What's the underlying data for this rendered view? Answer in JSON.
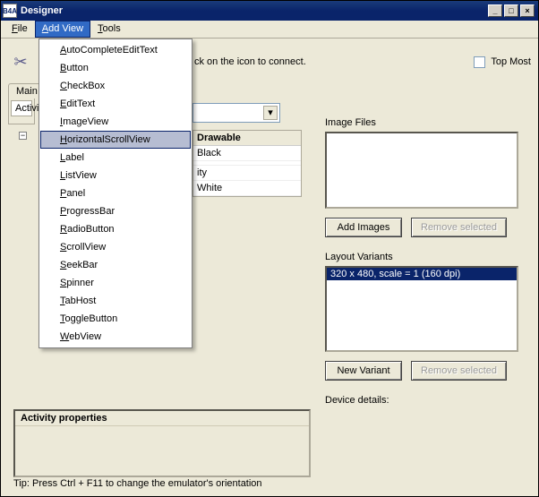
{
  "window": {
    "appicon_text": "B4A",
    "title": "Designer"
  },
  "menu": {
    "file": "File",
    "addview": "Add View",
    "tools": "Tools"
  },
  "addview_items": [
    {
      "mn": "A",
      "rest": "utoCompleteEditText"
    },
    {
      "mn": "B",
      "rest": "utton"
    },
    {
      "mn": "C",
      "rest": "heckBox"
    },
    {
      "mn": "E",
      "rest": "ditText"
    },
    {
      "mn": "I",
      "rest": "mageView"
    },
    {
      "mn": "H",
      "rest": "orizontalScrollView"
    },
    {
      "mn": "L",
      "rest": "abel"
    },
    {
      "mn": "L",
      "rest": "istView"
    },
    {
      "mn": "P",
      "rest": "anel"
    },
    {
      "mn": "P",
      "rest": "rogressBar"
    },
    {
      "mn": "R",
      "rest": "adioButton"
    },
    {
      "mn": "S",
      "rest": "crollView"
    },
    {
      "mn": "S",
      "rest": "eekBar"
    },
    {
      "mn": "S",
      "rest": "pinner"
    },
    {
      "mn": "T",
      "rest": "abHost"
    },
    {
      "mn": "T",
      "rest": "oggleButton"
    },
    {
      "mn": "W",
      "rest": "ebView"
    }
  ],
  "hovered_item_index": 5,
  "connect_text": "ck on the icon to connect.",
  "topmost_label": "Top Most",
  "tab_main": "Main",
  "tab_activity": "Activity",
  "tree_minus": "−",
  "props": {
    "header": "Drawable",
    "rows": [
      "Black",
      "",
      "ity",
      "White"
    ]
  },
  "activity_box_header": "Activity properties",
  "tip": "Tip: Press Ctrl + F11 to change the emulator's orientation",
  "right": {
    "image_files_label": "Image Files",
    "add_images_btn": "Add Images",
    "remove_selected_btn": "Remove selected",
    "layout_variants_label": "Layout Variants",
    "variant_selected": "320 x 480, scale = 1 (160 dpi)",
    "new_variant_btn": "New Variant",
    "remove_selected2_btn": "Remove selected",
    "device_details_label": "Device details:"
  },
  "wincontrols": {
    "min": "_",
    "max": "□",
    "close": "×"
  }
}
